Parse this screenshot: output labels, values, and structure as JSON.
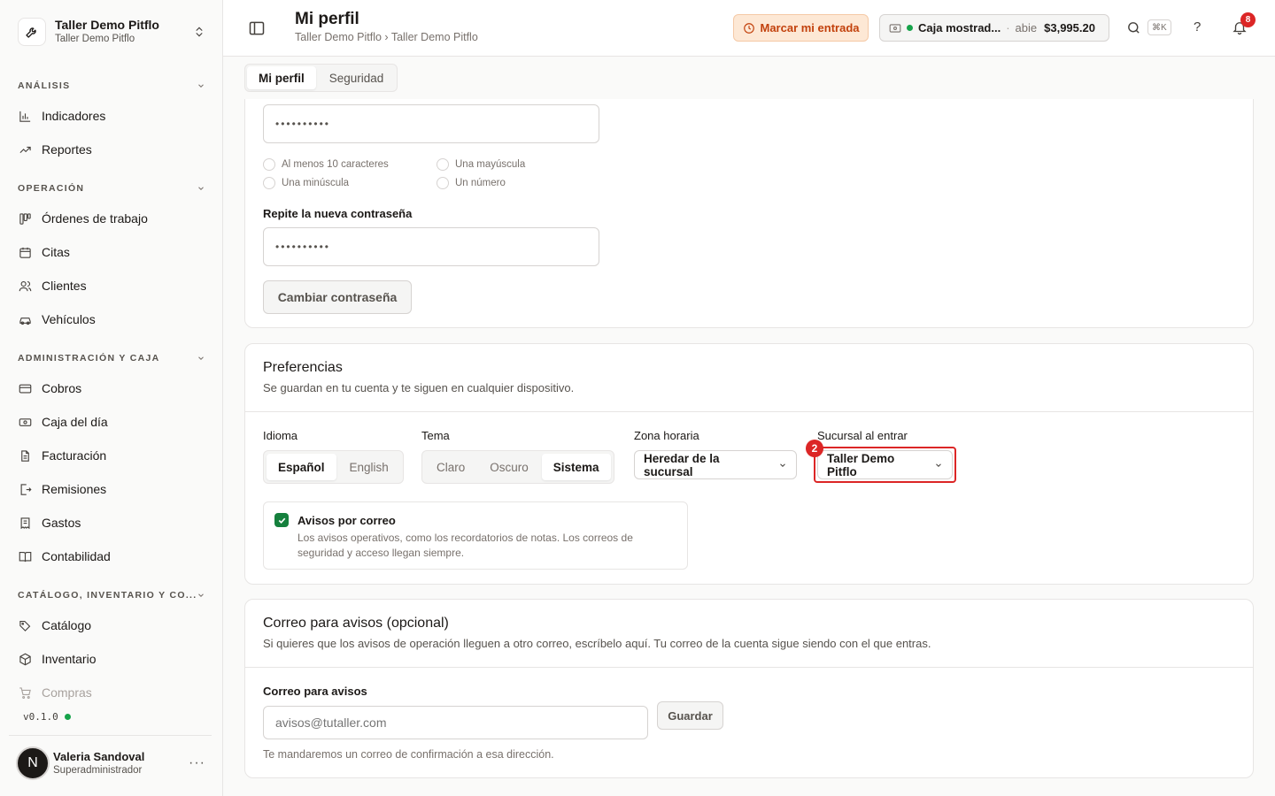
{
  "org": {
    "name": "Taller Demo Pitflo",
    "subtitle": "Taller Demo Pitflo"
  },
  "sidebar": {
    "sections": [
      {
        "label": "ANÁLISIS",
        "items": [
          {
            "label": "Indicadores",
            "icon": "bar-chart-icon"
          },
          {
            "label": "Reportes",
            "icon": "trend-icon"
          }
        ]
      },
      {
        "label": "OPERACIÓN",
        "items": [
          {
            "label": "Órdenes de trabajo",
            "icon": "kanban-icon"
          },
          {
            "label": "Citas",
            "icon": "calendar-icon"
          },
          {
            "label": "Clientes",
            "icon": "users-icon"
          },
          {
            "label": "Vehículos",
            "icon": "car-icon"
          }
        ]
      },
      {
        "label": "ADMINISTRACIÓN Y CAJA",
        "items": [
          {
            "label": "Cobros",
            "icon": "credit-card-icon"
          },
          {
            "label": "Caja del día",
            "icon": "cash-icon"
          },
          {
            "label": "Facturación",
            "icon": "file-icon"
          },
          {
            "label": "Remisiones",
            "icon": "file-export-icon"
          },
          {
            "label": "Gastos",
            "icon": "receipt-icon"
          },
          {
            "label": "Contabilidad",
            "icon": "book-icon"
          }
        ]
      },
      {
        "label": "CATÁLOGO, INVENTARIO Y CO...",
        "items": [
          {
            "label": "Catálogo",
            "icon": "tags-icon"
          },
          {
            "label": "Inventario",
            "icon": "box-icon"
          },
          {
            "label": "Compras",
            "icon": "cart-icon"
          }
        ]
      }
    ],
    "version": "v0.1.0",
    "user": {
      "initial": "N",
      "name": "Valeria Sandoval",
      "role": "Superadministrador",
      "menu": "···"
    }
  },
  "header": {
    "title": "Mi perfil",
    "breadcrumb": "Taller Demo Pitflo › Taller Demo Pitflo",
    "clock_in": "Marcar mi entrada",
    "register": {
      "name": "Caja mostrad...",
      "sep": "·",
      "state": "abie",
      "amount": "$3,995.20"
    },
    "search_shortcut": "⌘K",
    "help": "?",
    "notifications": "8"
  },
  "tabs": [
    {
      "label": "Mi perfil"
    },
    {
      "label": "Seguridad"
    }
  ],
  "password": {
    "new_value": "••••••••••",
    "requirements": [
      "Al menos 10 caracteres",
      "Una mayúscula",
      "Una minúscula",
      "Un número"
    ],
    "repeat_label": "Repite la nueva contraseña",
    "repeat_value": "••••••••••",
    "submit": "Cambiar contraseña"
  },
  "preferences": {
    "title": "Preferencias",
    "subtitle": "Se guardan en tu cuenta y te siguen en cualquier dispositivo.",
    "language": {
      "label": "Idioma",
      "options": [
        "Español",
        "English"
      ],
      "selected": "Español"
    },
    "theme": {
      "label": "Tema",
      "options": [
        "Claro",
        "Oscuro",
        "Sistema"
      ],
      "selected": "Sistema"
    },
    "timezone": {
      "label": "Zona horaria",
      "value": "Heredar de la sucursal"
    },
    "branch": {
      "label": "Sucursal al entrar",
      "value": "Taller Demo Pitflo",
      "marker": "2"
    },
    "email_notices": {
      "label": "Avisos por correo",
      "checked": true,
      "description": "Los avisos operativos, como los recordatorios de notas. Los correos de seguridad y acceso llegan siempre."
    }
  },
  "notice_email": {
    "title": "Correo para avisos (opcional)",
    "subtitle": "Si quieres que los avisos de operación lleguen a otro correo, escríbelo aquí. Tu correo de la cuenta sigue siendo con el que entras.",
    "field_label": "Correo para avisos",
    "placeholder": "avisos@tutaller.com",
    "save": "Guardar",
    "hint": "Te mandaremos un correo de confirmación a esa dirección."
  },
  "colors": {
    "accent": "#15803d",
    "highlight": "#dc2626",
    "clock_in_bg": "#fde8d5",
    "clock_in_text": "#c2410c"
  }
}
